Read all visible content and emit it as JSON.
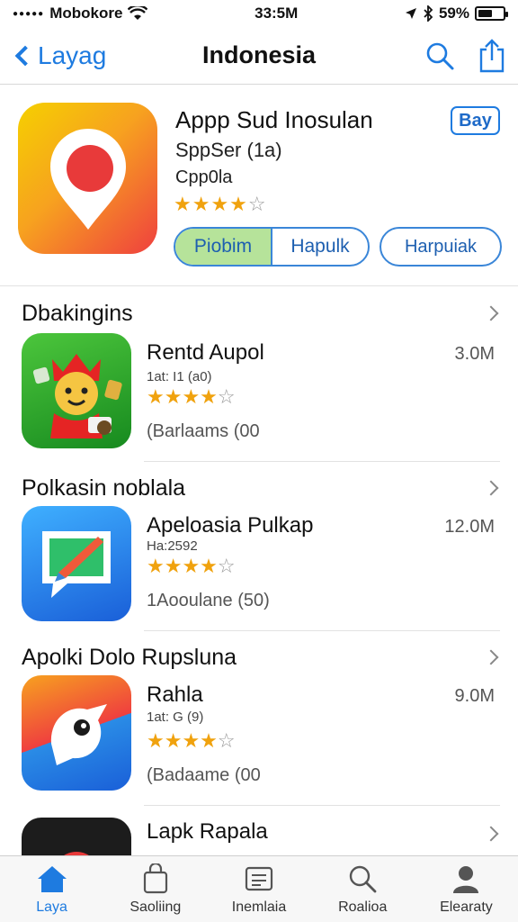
{
  "status_bar": {
    "carrier": "Mobokore",
    "time": "33:5M",
    "battery": "59%",
    "battery_level": 0.59
  },
  "nav": {
    "back_label": "Layag",
    "title": "Indonesia"
  },
  "featured": {
    "title": "Appp Sud Inosulan",
    "subtitle": "SppSer (1a)",
    "category": "Cpp0la",
    "rating": 4,
    "get_label": "Bay",
    "segment_a": "Piobim",
    "segment_b": "Hapulk",
    "secondary_button": "Harpuiak"
  },
  "sections": [
    {
      "heading": "Dbakingins",
      "app": {
        "name": "Rentd Aupol",
        "meta": "1at: I1 (a0)",
        "rating": 4,
        "reviews": "(Barlaams (00",
        "size": "3.0M"
      }
    },
    {
      "heading": "Polkasin noblala",
      "app": {
        "name": "Apeloasia Pulkap",
        "meta": "Ha:2592",
        "rating": 4,
        "reviews": "1Aooulane (50)",
        "size": "12.0M"
      }
    },
    {
      "heading": "Apolki Dolo Rupsluna",
      "app": {
        "name": "Rahla",
        "meta": "1at: G (9)",
        "rating": 4,
        "reviews": "(Badaame (00",
        "size": "9.0M"
      }
    },
    {
      "heading": "",
      "app": {
        "name": "Lapk Rapala",
        "meta": "",
        "rating": 0,
        "reviews": "",
        "size": ""
      }
    }
  ],
  "tabs": [
    {
      "label": "Laya",
      "icon": "home-icon",
      "active": true
    },
    {
      "label": "Saoliing",
      "icon": "bag-icon",
      "active": false
    },
    {
      "label": "Inemlaia",
      "icon": "list-icon",
      "active": false
    },
    {
      "label": "Roalioa",
      "icon": "search-icon",
      "active": false
    },
    {
      "label": "Elearaty",
      "icon": "person-icon",
      "active": false
    }
  ],
  "colors": {
    "accent": "#1e7be0",
    "star": "#f0a20e"
  }
}
